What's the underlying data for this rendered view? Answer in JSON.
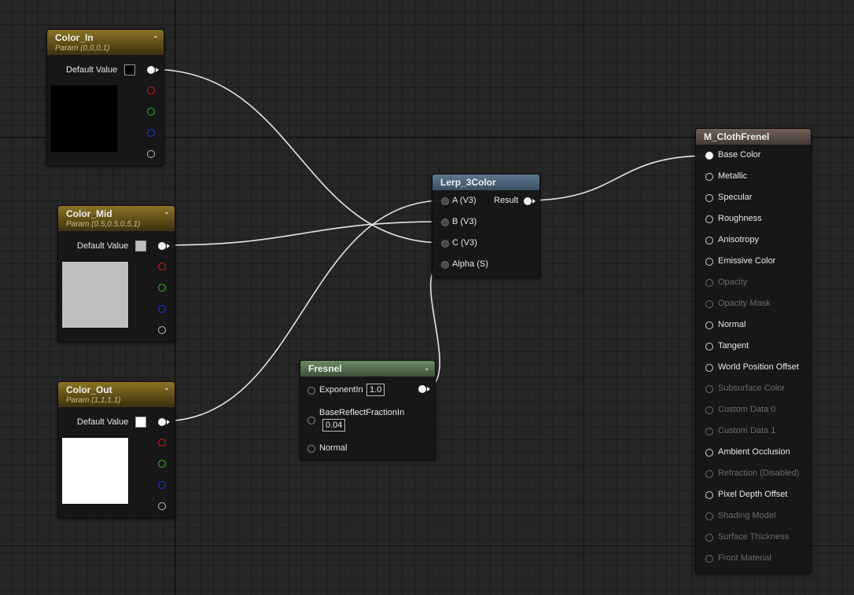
{
  "color_in": {
    "title": "Color_In",
    "subtitle": "Param (0,0,0,1)",
    "default_label": "Default Value",
    "swatch_color": "#000000"
  },
  "color_mid": {
    "title": "Color_Mid",
    "subtitle": "Param (0.5,0.5,0.5,1)",
    "default_label": "Default Value",
    "swatch_color": "#bfbfbf"
  },
  "color_out": {
    "title": "Color_Out",
    "subtitle": "Param (1,1,1,1)",
    "default_label": "Default Value",
    "swatch_color": "#ffffff"
  },
  "lerp": {
    "title": "Lerp_3Color",
    "inputs": [
      "A (V3)",
      "B (V3)",
      "C (V3)",
      "Alpha (S)"
    ],
    "output": "Result"
  },
  "fresnel": {
    "title": "Fresnel",
    "exponent_label": "ExponentIn",
    "exponent_value": "1.0",
    "base_label": "BaseReflectFractionIn",
    "base_value": "0.04",
    "normal_label": "Normal"
  },
  "material": {
    "title": "M_ClothFrenel",
    "inputs": [
      {
        "label": "Base Color",
        "enabled": true
      },
      {
        "label": "Metallic",
        "enabled": true
      },
      {
        "label": "Specular",
        "enabled": true
      },
      {
        "label": "Roughness",
        "enabled": true
      },
      {
        "label": "Anisotropy",
        "enabled": true
      },
      {
        "label": "Emissive Color",
        "enabled": true
      },
      {
        "label": "Opacity",
        "enabled": false
      },
      {
        "label": "Opacity Mask",
        "enabled": false
      },
      {
        "label": "Normal",
        "enabled": true
      },
      {
        "label": "Tangent",
        "enabled": true
      },
      {
        "label": "World Position Offset",
        "enabled": true
      },
      {
        "label": "Subsurface Color",
        "enabled": false
      },
      {
        "label": "Custom Data 0",
        "enabled": false
      },
      {
        "label": "Custom Data 1",
        "enabled": false
      },
      {
        "label": "Ambient Occlusion",
        "enabled": true
      },
      {
        "label": "Refraction (Disabled)",
        "enabled": false
      },
      {
        "label": "Pixel Depth Offset",
        "enabled": true
      },
      {
        "label": "Shading Model",
        "enabled": false
      },
      {
        "label": "Surface Thickness",
        "enabled": false
      },
      {
        "label": "Front Material",
        "enabled": false
      }
    ]
  },
  "colors": {
    "wire": "#e6e6e6",
    "param_header": "#7a6620",
    "red_pin": "#d42020",
    "green_pin": "#22c422",
    "blue_pin": "#2233dd"
  }
}
